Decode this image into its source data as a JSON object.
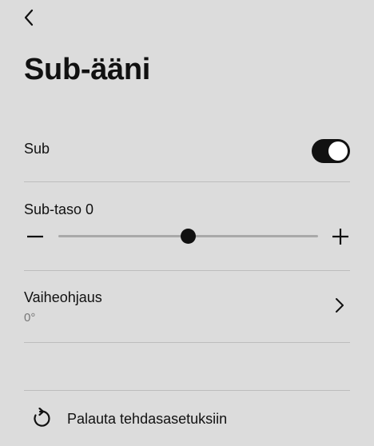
{
  "header": {
    "back_icon": "chevron-left-icon",
    "title": "Sub-ääni"
  },
  "sub_toggle": {
    "label": "Sub",
    "enabled": true
  },
  "sub_level": {
    "label": "Sub-taso 0",
    "value": 0,
    "min": -15,
    "max": 15,
    "minus_icon": "minus-icon",
    "plus_icon": "plus-icon"
  },
  "phase": {
    "label": "Vaiheohjaus",
    "value": "0°",
    "icon": "chevron-right-icon"
  },
  "reset": {
    "label": "Palauta tehdasasetuksiin",
    "icon": "reset-icon"
  },
  "colors": {
    "background": "#dcdcdc",
    "accent": "#111111",
    "divider": "#bdbdbd",
    "track": "#a9a9a9"
  }
}
